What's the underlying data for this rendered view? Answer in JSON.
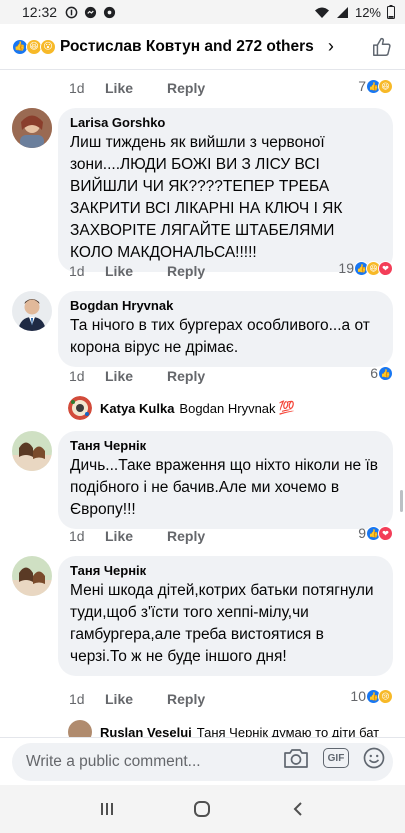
{
  "status": {
    "time": "12:32",
    "battery": "12%"
  },
  "header": {
    "reactors_text": "Ростислав Ковтун and 272 others",
    "chevron": "›"
  },
  "comments": [
    {
      "time": "1d",
      "like": "Like",
      "reply": "Reply",
      "count": "7"
    },
    {
      "author": "Larisa Gorshko",
      "text": "Лиш тиждень як вийшли з червоної зони....ЛЮДИ БОЖІ ВИ З ЛІСУ ВСІ ВИЙШЛИ   ЧИ ЯК????ТЕПЕР ТРЕБА ЗАКРИТИ ВСІ ЛІКАРНІ НА КЛЮЧ   І ЯК ЗАХВОРІТЕ ЛЯГАЙТЕ ШТАБЕЛЯМИ КОЛО МАКДОНАЛЬСА!!!!!",
      "time": "1d",
      "like": "Like",
      "reply": "Reply",
      "count": "19"
    },
    {
      "author": "Bogdan Hryvnak",
      "text": "Та нічого в тих бургерах особливого...а от корона вірус не дрімає.",
      "time": "1d",
      "like": "Like",
      "reply": "Reply",
      "count": "6"
    },
    {
      "author": "Таня Чернік",
      "text": "Дичь...Таке враження що ніхто ніколи не їв подібного і не бачив.Але ми хочемо в Європу!!!",
      "time": "1d",
      "like": "Like",
      "reply": "Reply",
      "count": "9"
    },
    {
      "author": "Таня Чернік",
      "text": "Мені шкода дітей,котрих батьки потягнули туди,щоб з'їсти того хеппі-мілу,чи гамбургера,але треба вистоятися в черзі.То ж не буде іншого дня!",
      "time": "1d",
      "like": "Like",
      "reply": "Reply",
      "count": "10"
    }
  ],
  "reply_preview": {
    "author": "Katya Kulka",
    "text": "Bogdan Hryvnak",
    "emoji": "💯"
  },
  "partial_reply": {
    "author": "Ruslan Veselui",
    "text": "Таня Чернік думаю то діти бат"
  },
  "composer": {
    "placeholder": "Write a public comment...",
    "gif": "GIF"
  },
  "colors": {
    "like_blue": "#1877f2",
    "haha_yellow": "#f7b928",
    "love_red": "#f33e58",
    "bubble": "#f0f2f5",
    "meta_gray": "#65676b"
  },
  "icons": [
    "like-icon",
    "haha-icon",
    "wow-icon",
    "love-icon",
    "sad-icon",
    "camera-icon",
    "gif-icon",
    "emoji-icon",
    "thumbs-up-icon"
  ]
}
